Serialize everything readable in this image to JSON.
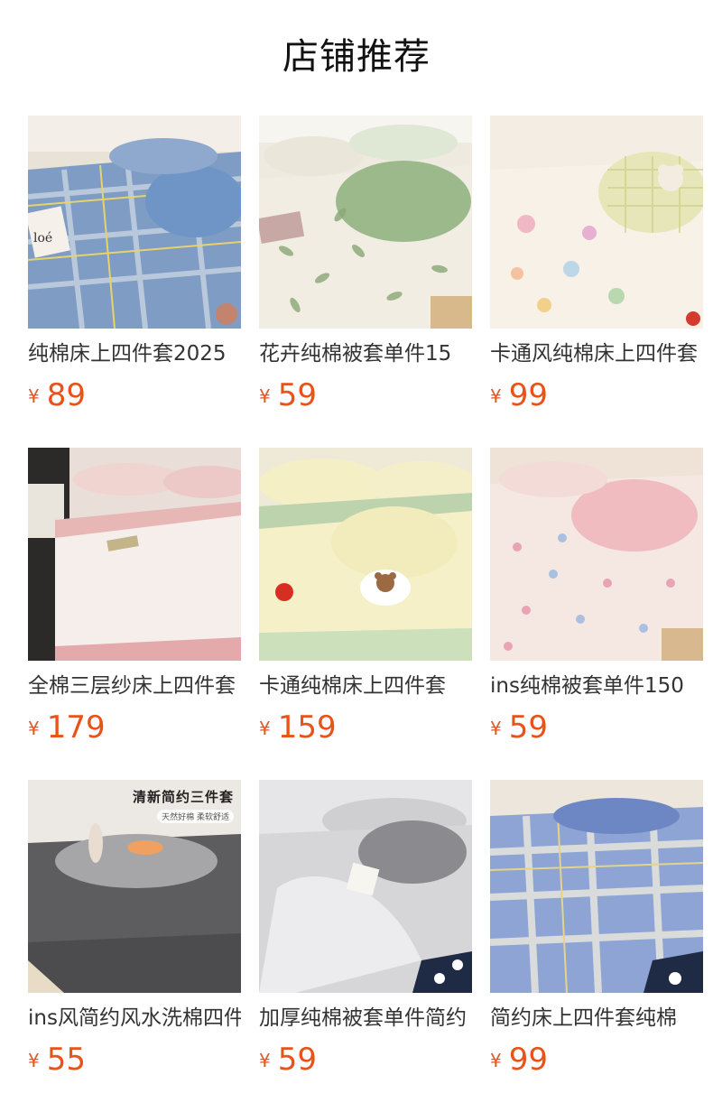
{
  "header": {
    "title": "店铺推荐"
  },
  "currency_symbol": "¥",
  "products": [
    {
      "name": "纯棉床上四件套2025",
      "price": "89",
      "image": "blue-plaid-bedding"
    },
    {
      "name": "花卉纯棉被套单件15",
      "price": "59",
      "image": "green-floral-bedding"
    },
    {
      "name": "卡通风纯棉床上四件套",
      "price": "99",
      "image": "cartoon-cream-bedding"
    },
    {
      "name": "全棉三层纱床上四件套",
      "price": "179",
      "image": "pink-gauze-bedding"
    },
    {
      "name": "卡通纯棉床上四件套",
      "price": "159",
      "image": "yellow-bear-bedding"
    },
    {
      "name": "ins纯棉被套单件150",
      "price": "59",
      "image": "pink-floral-bedding"
    },
    {
      "name": "ins风简约风水洗棉四件套",
      "price": "55",
      "image": "grey-bedding",
      "badge": "清新简约三件套",
      "tags": "天然好棉 柔软舒适"
    },
    {
      "name": "加厚纯棉被套单件简约",
      "price": "59",
      "image": "light-grey-bedding"
    },
    {
      "name": "简约床上四件套纯棉",
      "price": "99",
      "image": "blue-check-bedding"
    }
  ]
}
